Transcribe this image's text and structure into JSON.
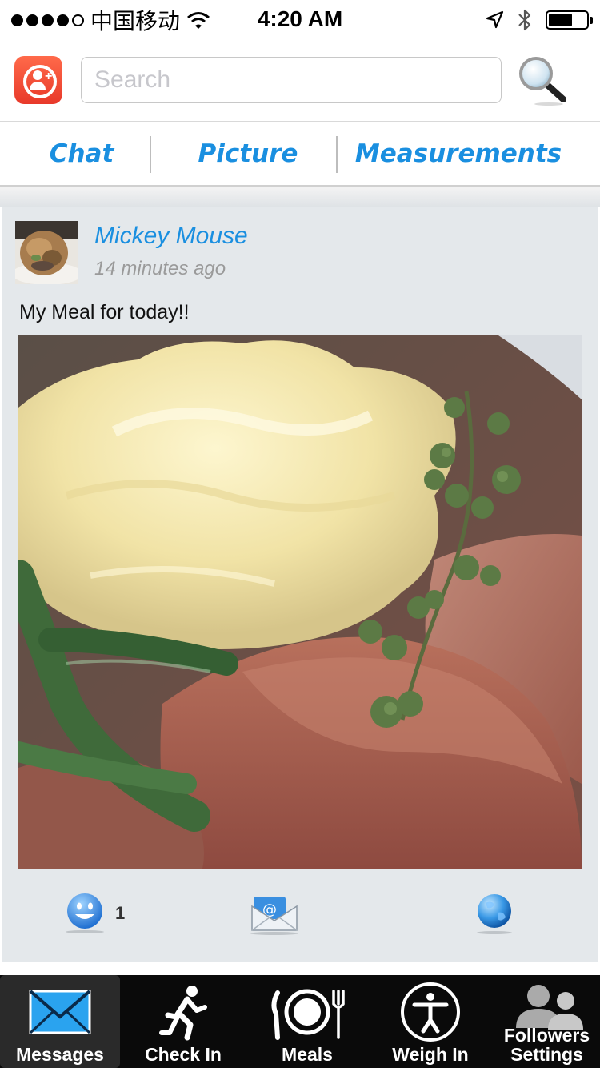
{
  "status_bar": {
    "carrier": "中国移动",
    "time": "4:20 AM",
    "signal_dots_filled": 4,
    "signal_dots_total": 5,
    "battery_level": 0.58
  },
  "search": {
    "placeholder": "Search"
  },
  "tabs": [
    {
      "label": "Chat"
    },
    {
      "label": "Picture"
    },
    {
      "label": "Measurements"
    }
  ],
  "post": {
    "author": "Mickey Mouse",
    "time_ago": "14 minutes ago",
    "text": "My Meal for today!!",
    "like_count": "1",
    "photo_subject": "plate of mashed potatoes, sliced roast meat and green beans"
  },
  "tab_bar": {
    "items": [
      {
        "label": "Messages",
        "icon": "envelope-icon",
        "active": true
      },
      {
        "label": "Check In",
        "icon": "running-person-icon",
        "active": false
      },
      {
        "label": "Meals",
        "icon": "plate-fork-knife-icon",
        "active": false
      },
      {
        "label": "Weigh In",
        "icon": "person-circle-icon",
        "active": false
      },
      {
        "label_line1": "Followers",
        "label_line2": "Settings",
        "icon": "people-icon",
        "active": false
      }
    ]
  },
  "colors": {
    "accent_blue": "#1a8fe0",
    "logo_red": "#e8392a",
    "tabbar_bg": "#0a0a0a",
    "feed_bg": "#e4e8eb"
  }
}
